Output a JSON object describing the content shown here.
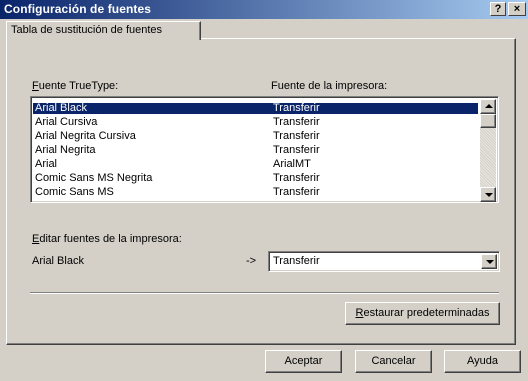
{
  "window": {
    "title": "Configuración de fuentes",
    "help_glyph": "?",
    "close_glyph": "×"
  },
  "tab": {
    "label": "Tabla de sustitución de fuentes"
  },
  "headers": {
    "truetype": "Fuente TrueType:",
    "printer": "Fuente de la impresora:"
  },
  "font_table": {
    "rows": [
      {
        "truetype": "Arial Black",
        "printer": "Transferir",
        "selected": true
      },
      {
        "truetype": "Arial Cursiva",
        "printer": "Transferir"
      },
      {
        "truetype": "Arial Negrita Cursiva",
        "printer": "Transferir"
      },
      {
        "truetype": "Arial Negrita",
        "printer": "Transferir"
      },
      {
        "truetype": "Arial",
        "printer": "ArialMT"
      },
      {
        "truetype": "Comic Sans MS Negrita",
        "printer": "Transferir"
      },
      {
        "truetype": "Comic Sans MS",
        "printer": "Transferir"
      }
    ]
  },
  "edit": {
    "label": "Editar fuentes de la impresora:",
    "current_font": "Arial Black",
    "arrow": "->",
    "selected_value": "Transferir"
  },
  "buttons": {
    "restore": "Restaurar predeterminadas",
    "ok": "Aceptar",
    "cancel": "Cancelar",
    "help": "Ayuda"
  },
  "colors": {
    "title_start": "#0a246a",
    "title_end": "#a6caf0",
    "selection": "#0a246a",
    "face": "#d4d0c8"
  }
}
